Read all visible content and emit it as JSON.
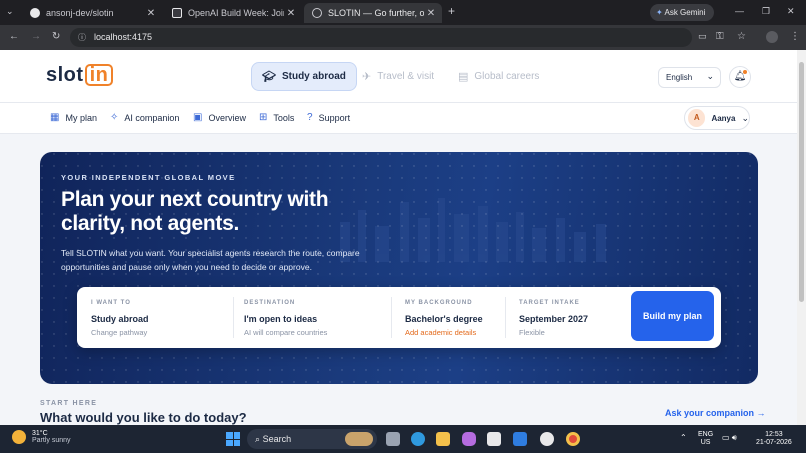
{
  "browser": {
    "tabs": [
      {
        "title": "ansonj-dev/slotin",
        "active": false
      },
      {
        "title": "OpenAI Build Week: Join a glob",
        "active": false
      },
      {
        "title": "SLOTIN — Go further, on your t",
        "active": true
      }
    ],
    "new_tab": "+",
    "ask_gemini": "Ask Gemini",
    "url": "localhost:4175"
  },
  "app": {
    "logo_text": "slot",
    "logo_accent": "in",
    "modes": [
      {
        "label": "Study abroad",
        "active": true
      },
      {
        "label": "Travel & visit",
        "active": false
      },
      {
        "label": "Global careers",
        "active": false
      }
    ],
    "language": "English",
    "nav": [
      "My plan",
      "AI companion",
      "Overview",
      "Tools",
      "Support"
    ],
    "user": {
      "initial": "A",
      "name": "Aanya"
    }
  },
  "hero": {
    "eyebrow": "YOUR INDEPENDENT GLOBAL MOVE",
    "headline": "Plan your next country with clarity, not agents.",
    "lede": "Tell SLOTIN what you want. Your specialist agents research the route, compare opportunities and pause only when you need to decide or approve.",
    "fields": [
      {
        "label": "I WANT TO",
        "value": "Study abroad",
        "sub": "Change pathway",
        "warn": false
      },
      {
        "label": "DESTINATION",
        "value": "I'm open to ideas",
        "sub": "AI will compare countries",
        "warn": false
      },
      {
        "label": "MY BACKGROUND",
        "value": "Bachelor's degree",
        "sub": "Add academic details",
        "warn": true
      },
      {
        "label": "TARGET INTAKE",
        "value": "September 2027",
        "sub": "Flexible",
        "warn": false
      }
    ],
    "cta": "Build my plan"
  },
  "section": {
    "eyebrow": "START HERE",
    "title": "What would you like to do today?",
    "link": "Ask your companion →"
  },
  "taskbar": {
    "temp": "31°C",
    "weather": "Partly sunny",
    "search": "Search",
    "lang_top": "ENG",
    "lang_bottom": "US",
    "time": "12:53",
    "date": "21-07-2026"
  },
  "colors": {
    "brand": "#2563eb",
    "accent": "#f0822a",
    "hero_bg": "#1a3a7c",
    "text": "#1c2a44"
  }
}
